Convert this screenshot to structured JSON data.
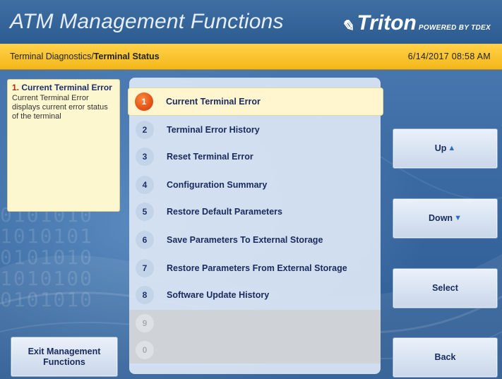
{
  "header": {
    "title": "ATM Management Functions",
    "logo_text": "Triton",
    "logo_sub": "POWERED BY TDEX"
  },
  "breadcrumb": {
    "path": "Terminal Diagnostics/",
    "current": "Terminal Status"
  },
  "datetime": "6/14/2017  08:58 AM",
  "help": {
    "number": "1.",
    "title": "Current Terminal Error",
    "body": "Current Terminal Error displays current error status of the terminal"
  },
  "menu": [
    {
      "num": "1",
      "label": "Current Terminal Error",
      "state": "selected"
    },
    {
      "num": "2",
      "label": "Terminal Error History",
      "state": "enabled"
    },
    {
      "num": "3",
      "label": "Reset Terminal Error",
      "state": "enabled"
    },
    {
      "num": "4",
      "label": "Configuration Summary",
      "state": "enabled"
    },
    {
      "num": "5",
      "label": "Restore Default Parameters",
      "state": "enabled"
    },
    {
      "num": "6",
      "label": "Save Parameters To External Storage",
      "state": "enabled"
    },
    {
      "num": "7",
      "label": "Restore Parameters From External Storage",
      "state": "enabled"
    },
    {
      "num": "8",
      "label": "Software Update History",
      "state": "enabled"
    },
    {
      "num": "9",
      "label": "",
      "state": "disabled"
    },
    {
      "num": "0",
      "label": "",
      "state": "disabled"
    }
  ],
  "buttons": {
    "up": "Up",
    "up_arrow": "▲",
    "down": "Down",
    "down_arrow": "▼",
    "select": "Select",
    "back": "Back",
    "exit_line1": "Exit Management",
    "exit_line2": "Functions"
  },
  "colors": {
    "accent_bar": "#f4b71a",
    "selected_badge": "#e2541a",
    "background": "#2f5f94"
  }
}
